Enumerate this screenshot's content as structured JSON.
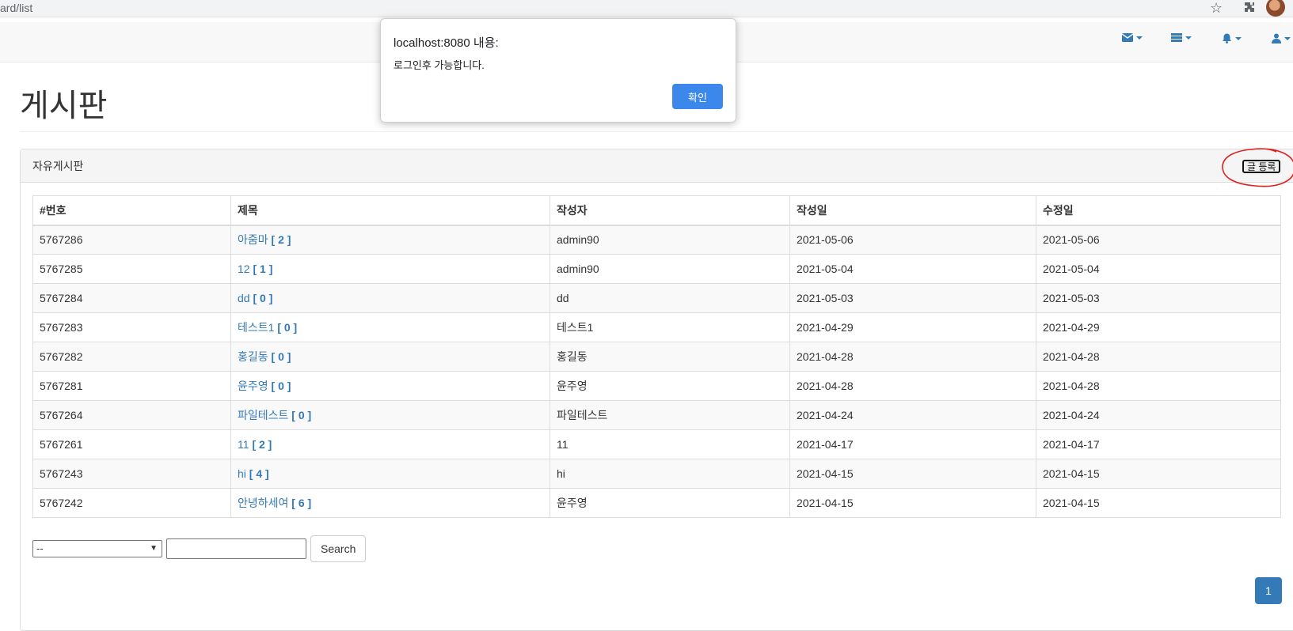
{
  "browser": {
    "url_fragment": "ard/list"
  },
  "page": {
    "title": "게시판"
  },
  "panel": {
    "heading": "자유게시판",
    "register_button": "글 등록"
  },
  "table": {
    "headers": [
      "#번호",
      "제목",
      "작성자",
      "작성일",
      "수정일"
    ],
    "rows": [
      {
        "no": "5767286",
        "title": "아줌마",
        "reply": "[ 2 ]",
        "writer": "admin90",
        "regdate": "2021-05-06",
        "updatedate": "2021-05-06"
      },
      {
        "no": "5767285",
        "title": "12",
        "reply": "[ 1 ]",
        "writer": "admin90",
        "regdate": "2021-05-04",
        "updatedate": "2021-05-04"
      },
      {
        "no": "5767284",
        "title": "dd",
        "reply": "[ 0 ]",
        "writer": "dd",
        "regdate": "2021-05-03",
        "updatedate": "2021-05-03"
      },
      {
        "no": "5767283",
        "title": "테스트1",
        "reply": "[ 0 ]",
        "writer": "테스트1",
        "regdate": "2021-04-29",
        "updatedate": "2021-04-29"
      },
      {
        "no": "5767282",
        "title": "홍길동",
        "reply": "[ 0 ]",
        "writer": "홍길동",
        "regdate": "2021-04-28",
        "updatedate": "2021-04-28"
      },
      {
        "no": "5767281",
        "title": "윤주영",
        "reply": "[ 0 ]",
        "writer": "윤주영",
        "regdate": "2021-04-28",
        "updatedate": "2021-04-28"
      },
      {
        "no": "5767264",
        "title": "파일테스트",
        "reply": "[ 0 ]",
        "writer": "파일테스트",
        "regdate": "2021-04-24",
        "updatedate": "2021-04-24"
      },
      {
        "no": "5767261",
        "title": "11",
        "reply": "[ 2 ]",
        "writer": "11",
        "regdate": "2021-04-17",
        "updatedate": "2021-04-17"
      },
      {
        "no": "5767243",
        "title": "hi",
        "reply": "[ 4 ]",
        "writer": "hi",
        "regdate": "2021-04-15",
        "updatedate": "2021-04-15"
      },
      {
        "no": "5767242",
        "title": "안녕하세여",
        "reply": "[ 6 ]",
        "writer": "윤주영",
        "regdate": "2021-04-15",
        "updatedate": "2021-04-15"
      }
    ]
  },
  "search": {
    "type_selected": "--",
    "keyword": "",
    "button": "Search"
  },
  "pagination": {
    "current": "1"
  },
  "alert": {
    "title": "localhost:8080 내용:",
    "message": "로그인후 가능합니다.",
    "ok": "확인"
  },
  "icons": [
    "star-icon",
    "puzzle-icon",
    "envelope-icon",
    "tasks-icon",
    "bell-icon",
    "user-icon"
  ],
  "colors": {
    "link": "#337ab7",
    "primary": "#337ab7",
    "dialog_button": "#1a73e8",
    "annotation": "#e02020"
  }
}
